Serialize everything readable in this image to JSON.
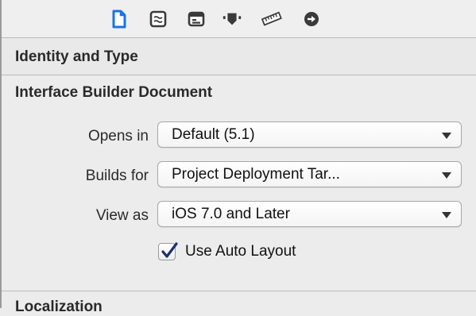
{
  "toolbar": {
    "icons": [
      "file-inspector-icon",
      "quick-help-icon",
      "identity-inspector-icon",
      "attributes-inspector-icon",
      "size-inspector-icon",
      "connections-inspector-icon"
    ]
  },
  "sections": {
    "identity_and_type": "Identity and Type",
    "interface_builder_document": "Interface Builder Document",
    "localization": "Localization"
  },
  "ib_document": {
    "opens_in": {
      "label": "Opens in",
      "value": "Default (5.1)"
    },
    "builds_for": {
      "label": "Builds for",
      "value": "Project Deployment Tar..."
    },
    "view_as": {
      "label": "View as",
      "value": "iOS 7.0 and Later"
    },
    "use_auto_layout": {
      "label": "Use Auto Layout",
      "checked": true
    }
  },
  "colors": {
    "accent": "#1a73e8",
    "checkmark": "#1f2f6e"
  }
}
